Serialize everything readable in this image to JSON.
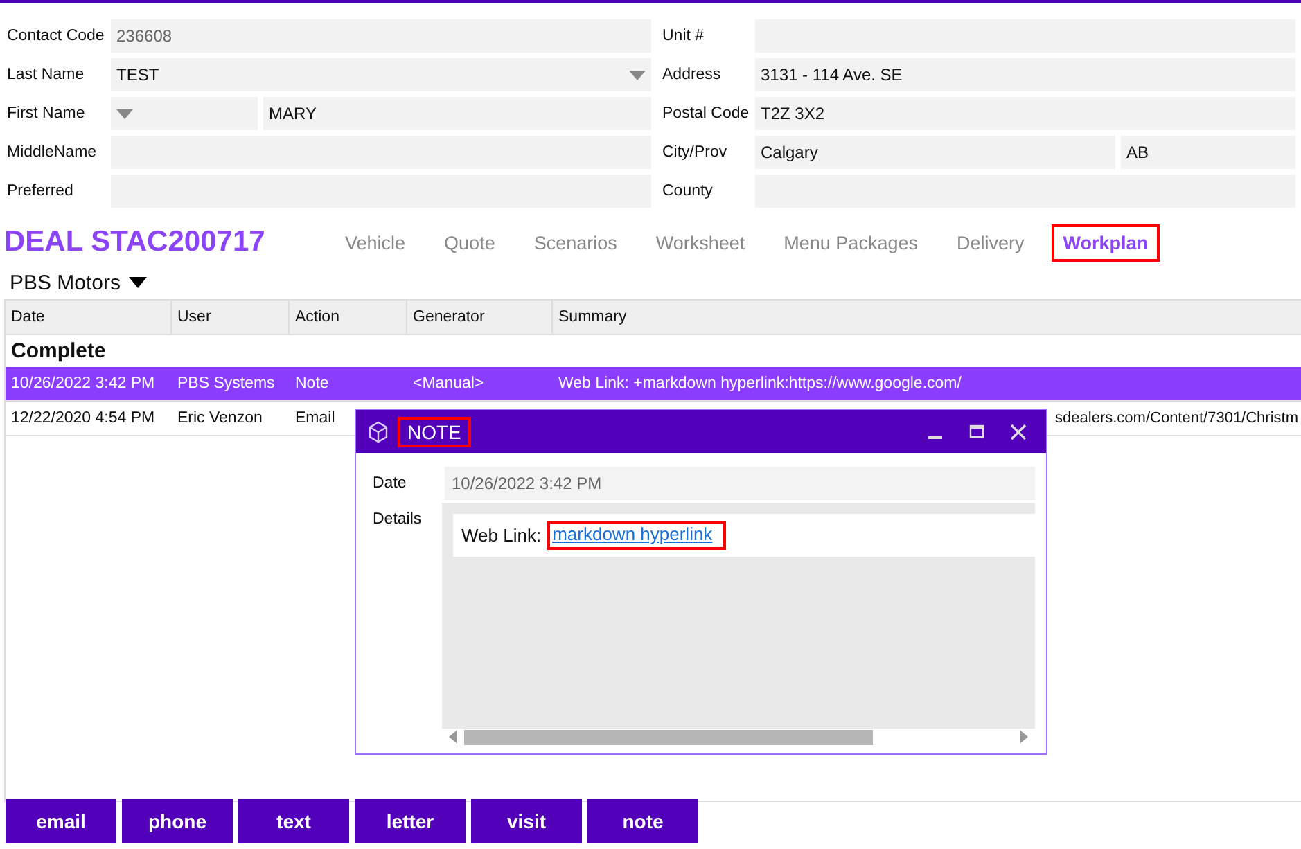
{
  "contact_form": {
    "left": [
      {
        "label": "Contact Code",
        "fields": [
          {
            "value": "236608",
            "kind": "readonly"
          }
        ]
      },
      {
        "label": "Last Name",
        "fields": [
          {
            "value": "TEST",
            "kind": "dropdown"
          }
        ]
      },
      {
        "label": "First Name",
        "fields": [
          {
            "kind": "dropdown"
          },
          {
            "value": "MARY",
            "kind": "text"
          }
        ]
      },
      {
        "label": "MiddleName",
        "fields": [
          {
            "kind": "text"
          }
        ]
      },
      {
        "label": "Preferred",
        "fields": [
          {
            "kind": "text"
          }
        ]
      }
    ],
    "right": [
      {
        "label": "Unit #",
        "fields": [
          {
            "kind": "text"
          }
        ]
      },
      {
        "label": "Address",
        "fields": [
          {
            "value": "3131 - 114 Ave. SE",
            "kind": "text"
          }
        ]
      },
      {
        "label": "Postal Code",
        "fields": [
          {
            "value": "T2Z 3X2",
            "kind": "text"
          }
        ]
      },
      {
        "label": "City/Prov",
        "fields": [
          {
            "value": "Calgary",
            "kind": "text"
          },
          {
            "value": "AB",
            "kind": "text"
          }
        ]
      },
      {
        "label": "County",
        "fields": [
          {
            "kind": "text"
          }
        ]
      }
    ]
  },
  "deal_title": "DEAL STAC200717",
  "tabs": [
    {
      "label": "Vehicle",
      "selected": false
    },
    {
      "label": "Quote",
      "selected": false
    },
    {
      "label": "Scenarios",
      "selected": false
    },
    {
      "label": "Worksheet",
      "selected": false
    },
    {
      "label": "Menu Packages",
      "selected": false
    },
    {
      "label": "Delivery",
      "selected": false
    },
    {
      "label": "Workplan",
      "selected": true
    }
  ],
  "dealer": "PBS Motors",
  "table": {
    "columns": [
      "Date",
      "User",
      "Action",
      "Generator",
      "Summary"
    ],
    "group": "Complete",
    "rows": [
      {
        "cells": [
          "10/26/2022 3:42 PM",
          "PBS Systems",
          "Note",
          "<Manual>",
          "Web Link: +markdown hyperlink:https://www.google.com/"
        ],
        "selected": true
      },
      {
        "cells": [
          "12/22/2020 4:54 PM",
          "Eric Venzon",
          "Email",
          "",
          "sdealers.com/Content/7301/Christm"
        ],
        "selected": false
      }
    ]
  },
  "dialog": {
    "title": "NOTE",
    "date_label": "Date",
    "date_value": "10/26/2022 3:42 PM",
    "details_label": "Details",
    "details_prefix": "Web Link:",
    "details_link": "markdown hyperlink"
  },
  "buttons": [
    "email",
    "phone",
    "text",
    "letter",
    "visit",
    "note"
  ]
}
